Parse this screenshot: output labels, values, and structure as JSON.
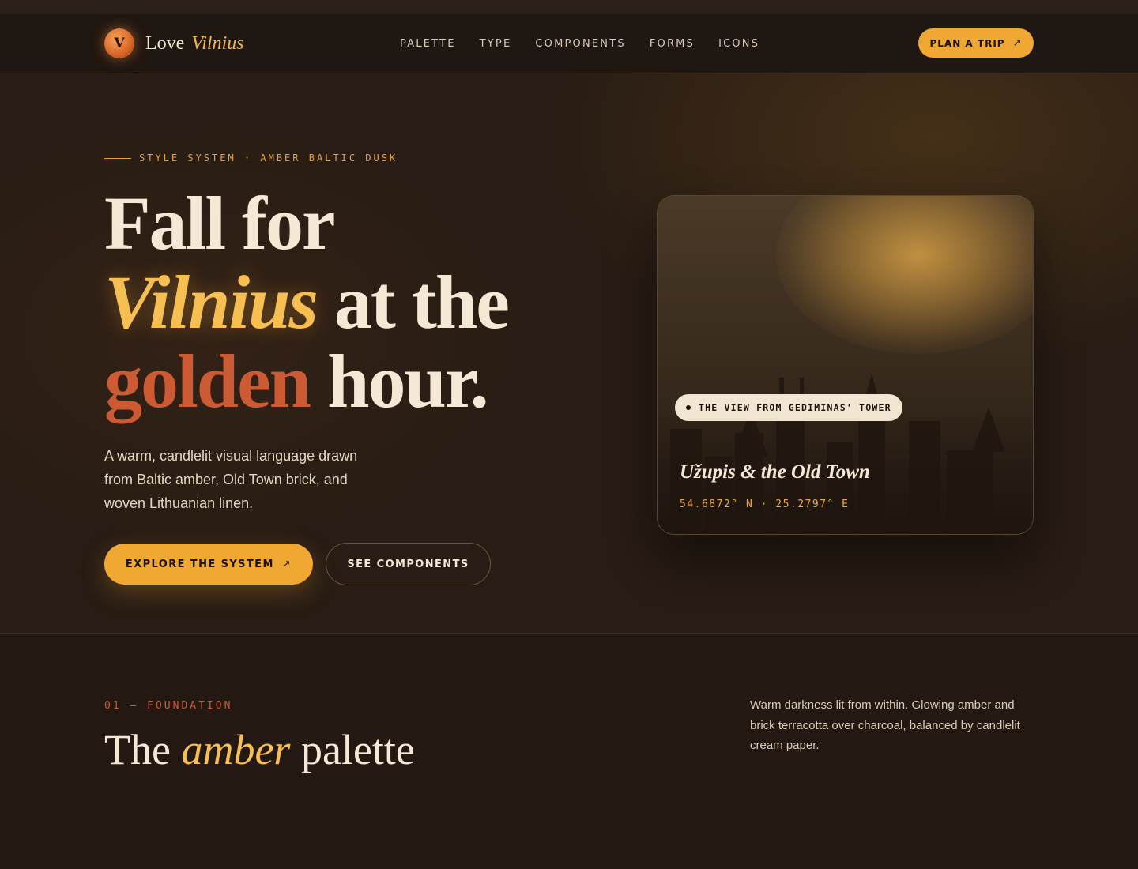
{
  "nav": {
    "brand_mark": "V",
    "brand_word": "Love",
    "brand_accent": "Vilnius",
    "links": [
      "PALETTE",
      "TYPE",
      "COMPONENTS",
      "FORMS",
      "ICONS"
    ],
    "cta_label": "PLAN A TRIP",
    "cta_icon": "arrow-up-right-icon"
  },
  "hero": {
    "eyebrow": "STYLE SYSTEM · AMBER BALTIC DUSK",
    "headline": {
      "line1": "Fall for",
      "line2_accent": "Vilnius",
      "line2_rest": "at the",
      "line3_accent": "golden",
      "line3_rest": "hour."
    },
    "description": "A warm, candlelit visual language drawn from Baltic amber, Old Town brick, and woven Lithuanian linen.",
    "primary_button": "EXPLORE THE SYSTEM",
    "secondary_button": "SEE COMPONENTS",
    "card": {
      "tag": "THE VIEW FROM GEDIMINAS' TOWER",
      "title": "Užupis & the Old Town",
      "coords": "54.6872° N · 25.2797° E"
    }
  },
  "section": {
    "eyebrow": "01 — FOUNDATION",
    "title_prefix": "The",
    "title_accent": "amber",
    "title_suffix": "palette",
    "description": "Warm darkness lit from within. Glowing amber and brick terracotta over charcoal, balanced by candlelit cream paper."
  },
  "colors": {
    "amber": "#f0a832",
    "amber_light": "#f7bf52",
    "terracotta": "#cc5a32",
    "charcoal": "#231912",
    "cream": "#f2e6d2"
  }
}
